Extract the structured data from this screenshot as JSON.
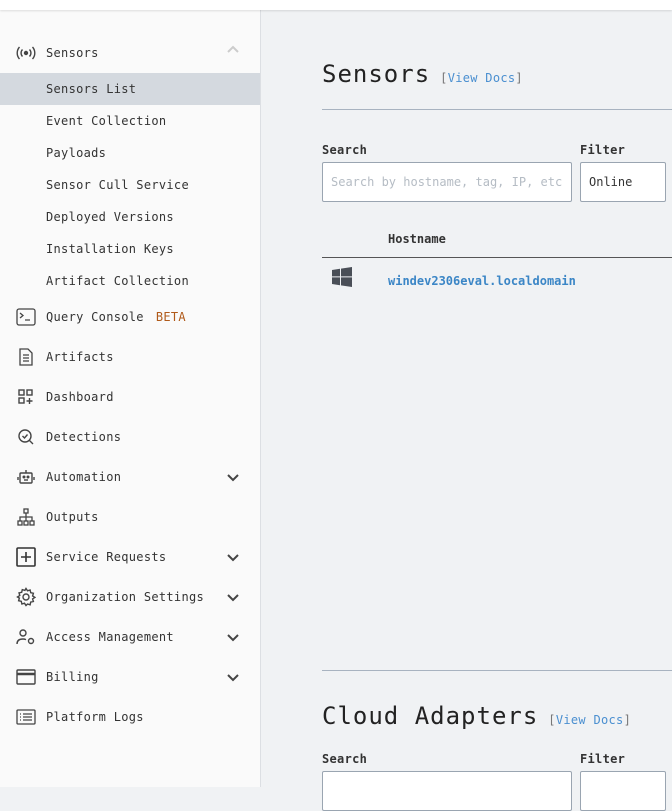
{
  "sidebar": {
    "sensors": {
      "label": "Sensors",
      "icon": "broadcast-icon"
    },
    "sub_items": [
      "Sensors List",
      "Event Collection",
      "Payloads",
      "Sensor Cull Service",
      "Deployed Versions",
      "Installation Keys",
      "Artifact Collection"
    ],
    "active": "Sensors List",
    "items": [
      {
        "label": "Query Console",
        "badge": "BETA",
        "icon": "terminal-icon"
      },
      {
        "label": "Artifacts",
        "icon": "document-icon"
      },
      {
        "label": "Dashboard",
        "icon": "grid-plus-icon"
      },
      {
        "label": "Detections",
        "icon": "search-check-icon"
      },
      {
        "label": "Automation",
        "icon": "robot-icon",
        "expandable": true
      },
      {
        "label": "Outputs",
        "icon": "hierarchy-icon"
      },
      {
        "label": "Service Requests",
        "icon": "plus-box-icon",
        "expandable": true
      },
      {
        "label": "Organization Settings",
        "icon": "gear-icon",
        "expandable": true
      },
      {
        "label": "Access Management",
        "icon": "user-gear-icon",
        "expandable": true
      },
      {
        "label": "Billing",
        "icon": "credit-card-icon",
        "expandable": true
      },
      {
        "label": "Platform Logs",
        "icon": "list-icon"
      }
    ]
  },
  "sensors_section": {
    "title": "Sensors",
    "docs_open": "[",
    "docs_label": "View Docs",
    "docs_close": "]",
    "search_label": "Search",
    "search_placeholder": "Search by hostname, tag, IP, etc...",
    "filter_label": "Filter",
    "filter_value": "Online",
    "table": {
      "columns": [
        "Hostname"
      ],
      "rows": [
        {
          "os": "windows-icon",
          "hostname": "windev2306eval.localdomain"
        }
      ]
    }
  },
  "cloud_section": {
    "title": "Cloud Adapters",
    "docs_open": "[",
    "docs_label": "View Docs",
    "docs_close": "]",
    "search_label": "Search",
    "filter_label": "Filter"
  },
  "colors": {
    "accent": "#3b86c6",
    "beta": "#b05a1a",
    "active_bg": "#d4d9df"
  }
}
